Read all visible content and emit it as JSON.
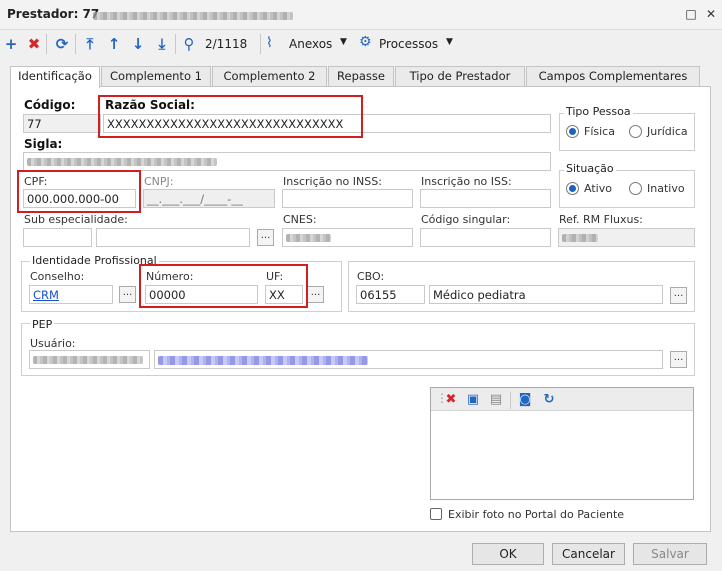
{
  "window": {
    "title": "Prestador: 77"
  },
  "toolbar": {
    "page_counter": "2/1118",
    "anexos_label": "Anexos",
    "processos_label": "Processos"
  },
  "tabs": [
    {
      "label": "Identificação"
    },
    {
      "label": "Complemento 1"
    },
    {
      "label": "Complemento 2"
    },
    {
      "label": "Repasse"
    },
    {
      "label": "Tipo de Prestador"
    },
    {
      "label": "Campos Complementares"
    }
  ],
  "form": {
    "codigo_label": "Código:",
    "codigo_value": "77",
    "razao_label": "Razão Social:",
    "razao_value": "XXXXXXXXXXXXXXXXXXXXXXXXXXXXXX",
    "sigla_label": "Sigla:",
    "cpf_label": "CPF:",
    "cpf_value": "000.000.000-00",
    "cnpj_label": "CNPJ:",
    "cnpj_value": "__.___.___/____-__",
    "inss_label": "Inscrição no INSS:",
    "iss_label": "Inscrição no ISS:",
    "subesp_label": "Sub especialidade:",
    "cnes_label": "CNES:",
    "codsing_label": "Código singular:",
    "refrm_label": "Ref. RM Fluxus:",
    "tipo_pessoa": {
      "title": "Tipo Pessoa",
      "opt1": "Física",
      "opt2": "Jurídica"
    },
    "situacao": {
      "title": "Situação",
      "opt1": "Ativo",
      "opt2": "Inativo"
    },
    "identidade": {
      "title": "Identidade Profissional",
      "conselho_label": "Conselho:",
      "conselho_value": "CRM",
      "numero_label": "Número:",
      "numero_value": "00000",
      "uf_label": "UF:",
      "uf_value": "XX"
    },
    "cbo": {
      "title": "CBO:",
      "code": "06155",
      "description": "Médico pediatra"
    },
    "pep": {
      "title": "PEP",
      "usuario_label": "Usuário:"
    },
    "foto_checkbox": "Exibir foto no Portal do Paciente"
  },
  "buttons": {
    "ok": "OK",
    "cancel": "Cancelar",
    "save": "Salvar"
  },
  "colors": {
    "highlight": "#d01f1f",
    "delete_icon": "#d3272b",
    "toolbar_icon": "#2366c2"
  }
}
